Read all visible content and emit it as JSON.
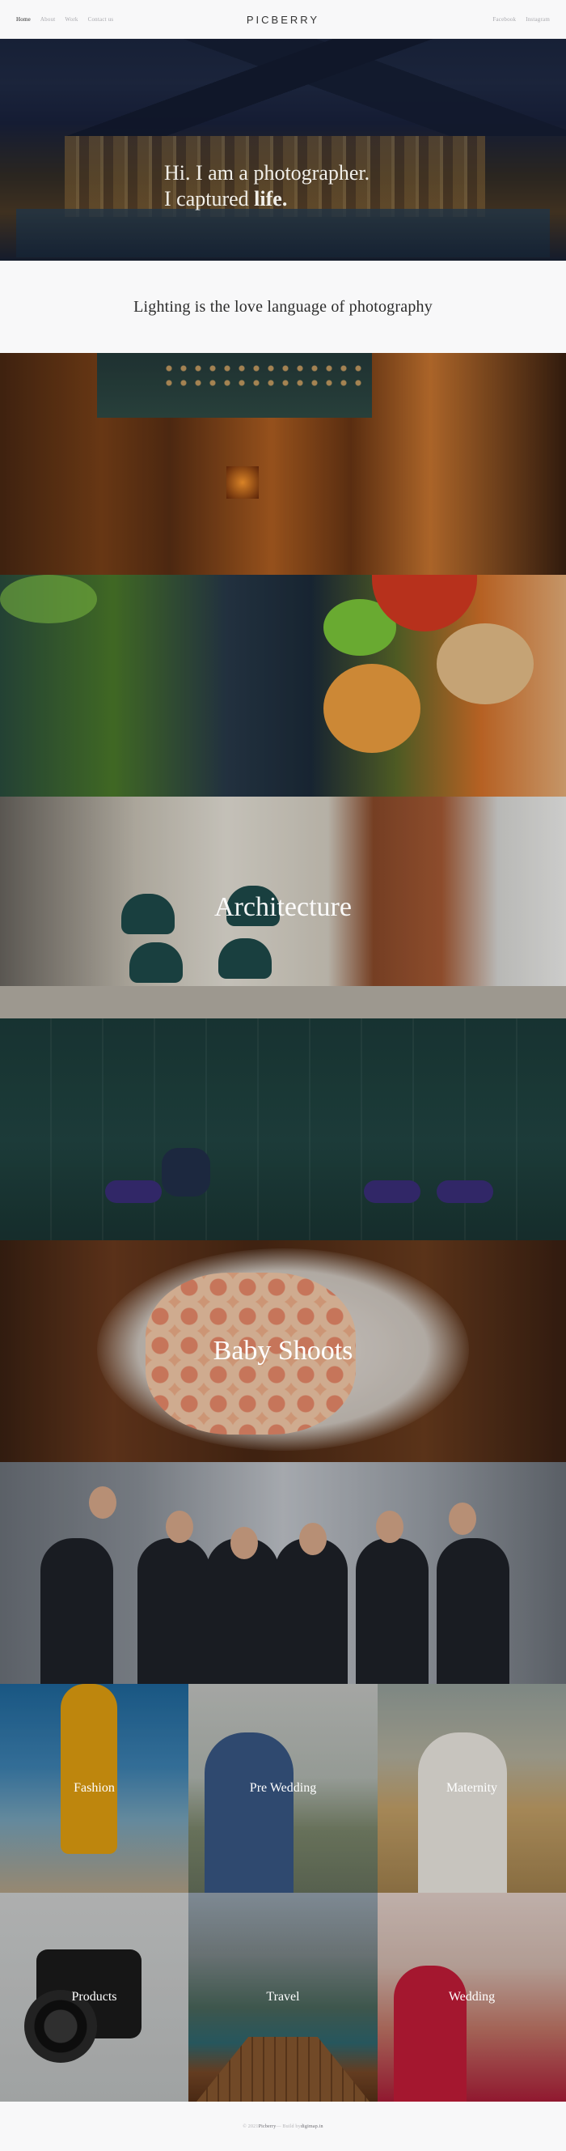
{
  "nav": {
    "left": [
      "Home",
      "About",
      "Work",
      "Contact us"
    ],
    "logo": "PICBERRY",
    "right": [
      "Facebook",
      "Instagram"
    ]
  },
  "hero": {
    "line1": "Hi. I am a photographer.",
    "line2_prefix": "I captured ",
    "line2_bold": "life."
  },
  "quote": {
    "text": "Lighting is the love language of photography"
  },
  "bands": {
    "interior": "",
    "food": "",
    "architecture": "Architecture",
    "teal": "",
    "baby": "Baby Shoots",
    "team": ""
  },
  "grid": [
    {
      "label": "Fashion"
    },
    {
      "label": "Pre Wedding"
    },
    {
      "label": "Maternity"
    },
    {
      "label": "Products"
    },
    {
      "label": "Travel"
    },
    {
      "label": "Wedding"
    }
  ],
  "footer": {
    "prefix": "© 2021 ",
    "brand": "Picberry",
    "middle": " — Build by ",
    "by": "digimap.in"
  }
}
